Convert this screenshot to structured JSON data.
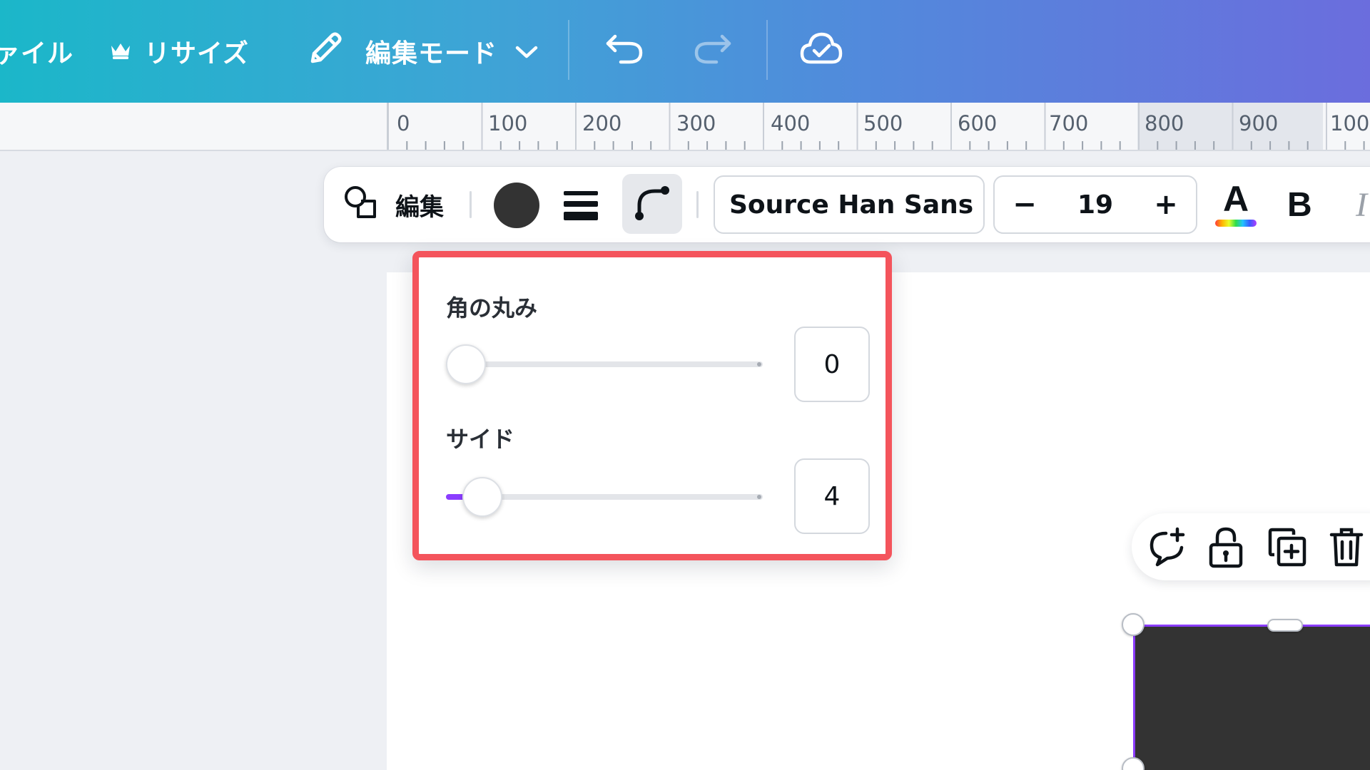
{
  "topbar": {
    "file_label": "ァイル",
    "resize_label": "リサイズ",
    "edit_mode_label": "編集モード",
    "icons": [
      "crown-icon",
      "pencil-icon",
      "chevron-down-icon",
      "undo-icon",
      "redo-icon",
      "cloud-check-icon"
    ]
  },
  "ruler": {
    "labels": [
      "0",
      "100",
      "200",
      "300",
      "400",
      "500",
      "600",
      "700",
      "800",
      "900",
      "100"
    ]
  },
  "toolbar": {
    "edit_label": "編集",
    "fill_color": "#333333",
    "font_name": "Source Han Sans ...",
    "font_size": "19",
    "decrease_label": "−",
    "increase_label": "+",
    "text_color_label": "A",
    "bold_label": "B",
    "italic_label": "I"
  },
  "popover": {
    "corner_radius_label": "角の丸み",
    "corner_radius_value": "0",
    "corner_radius_fraction": 0.0,
    "sides_label": "サイド",
    "sides_value": "4",
    "sides_fraction": 0.06
  },
  "colors": {
    "accent": "#8b3dff",
    "highlight_border": "#f4545c",
    "shape_fill": "#333333"
  },
  "element_actions": {
    "icons": [
      "comment-add-icon",
      "unlock-icon",
      "duplicate-icon",
      "trash-icon"
    ]
  }
}
